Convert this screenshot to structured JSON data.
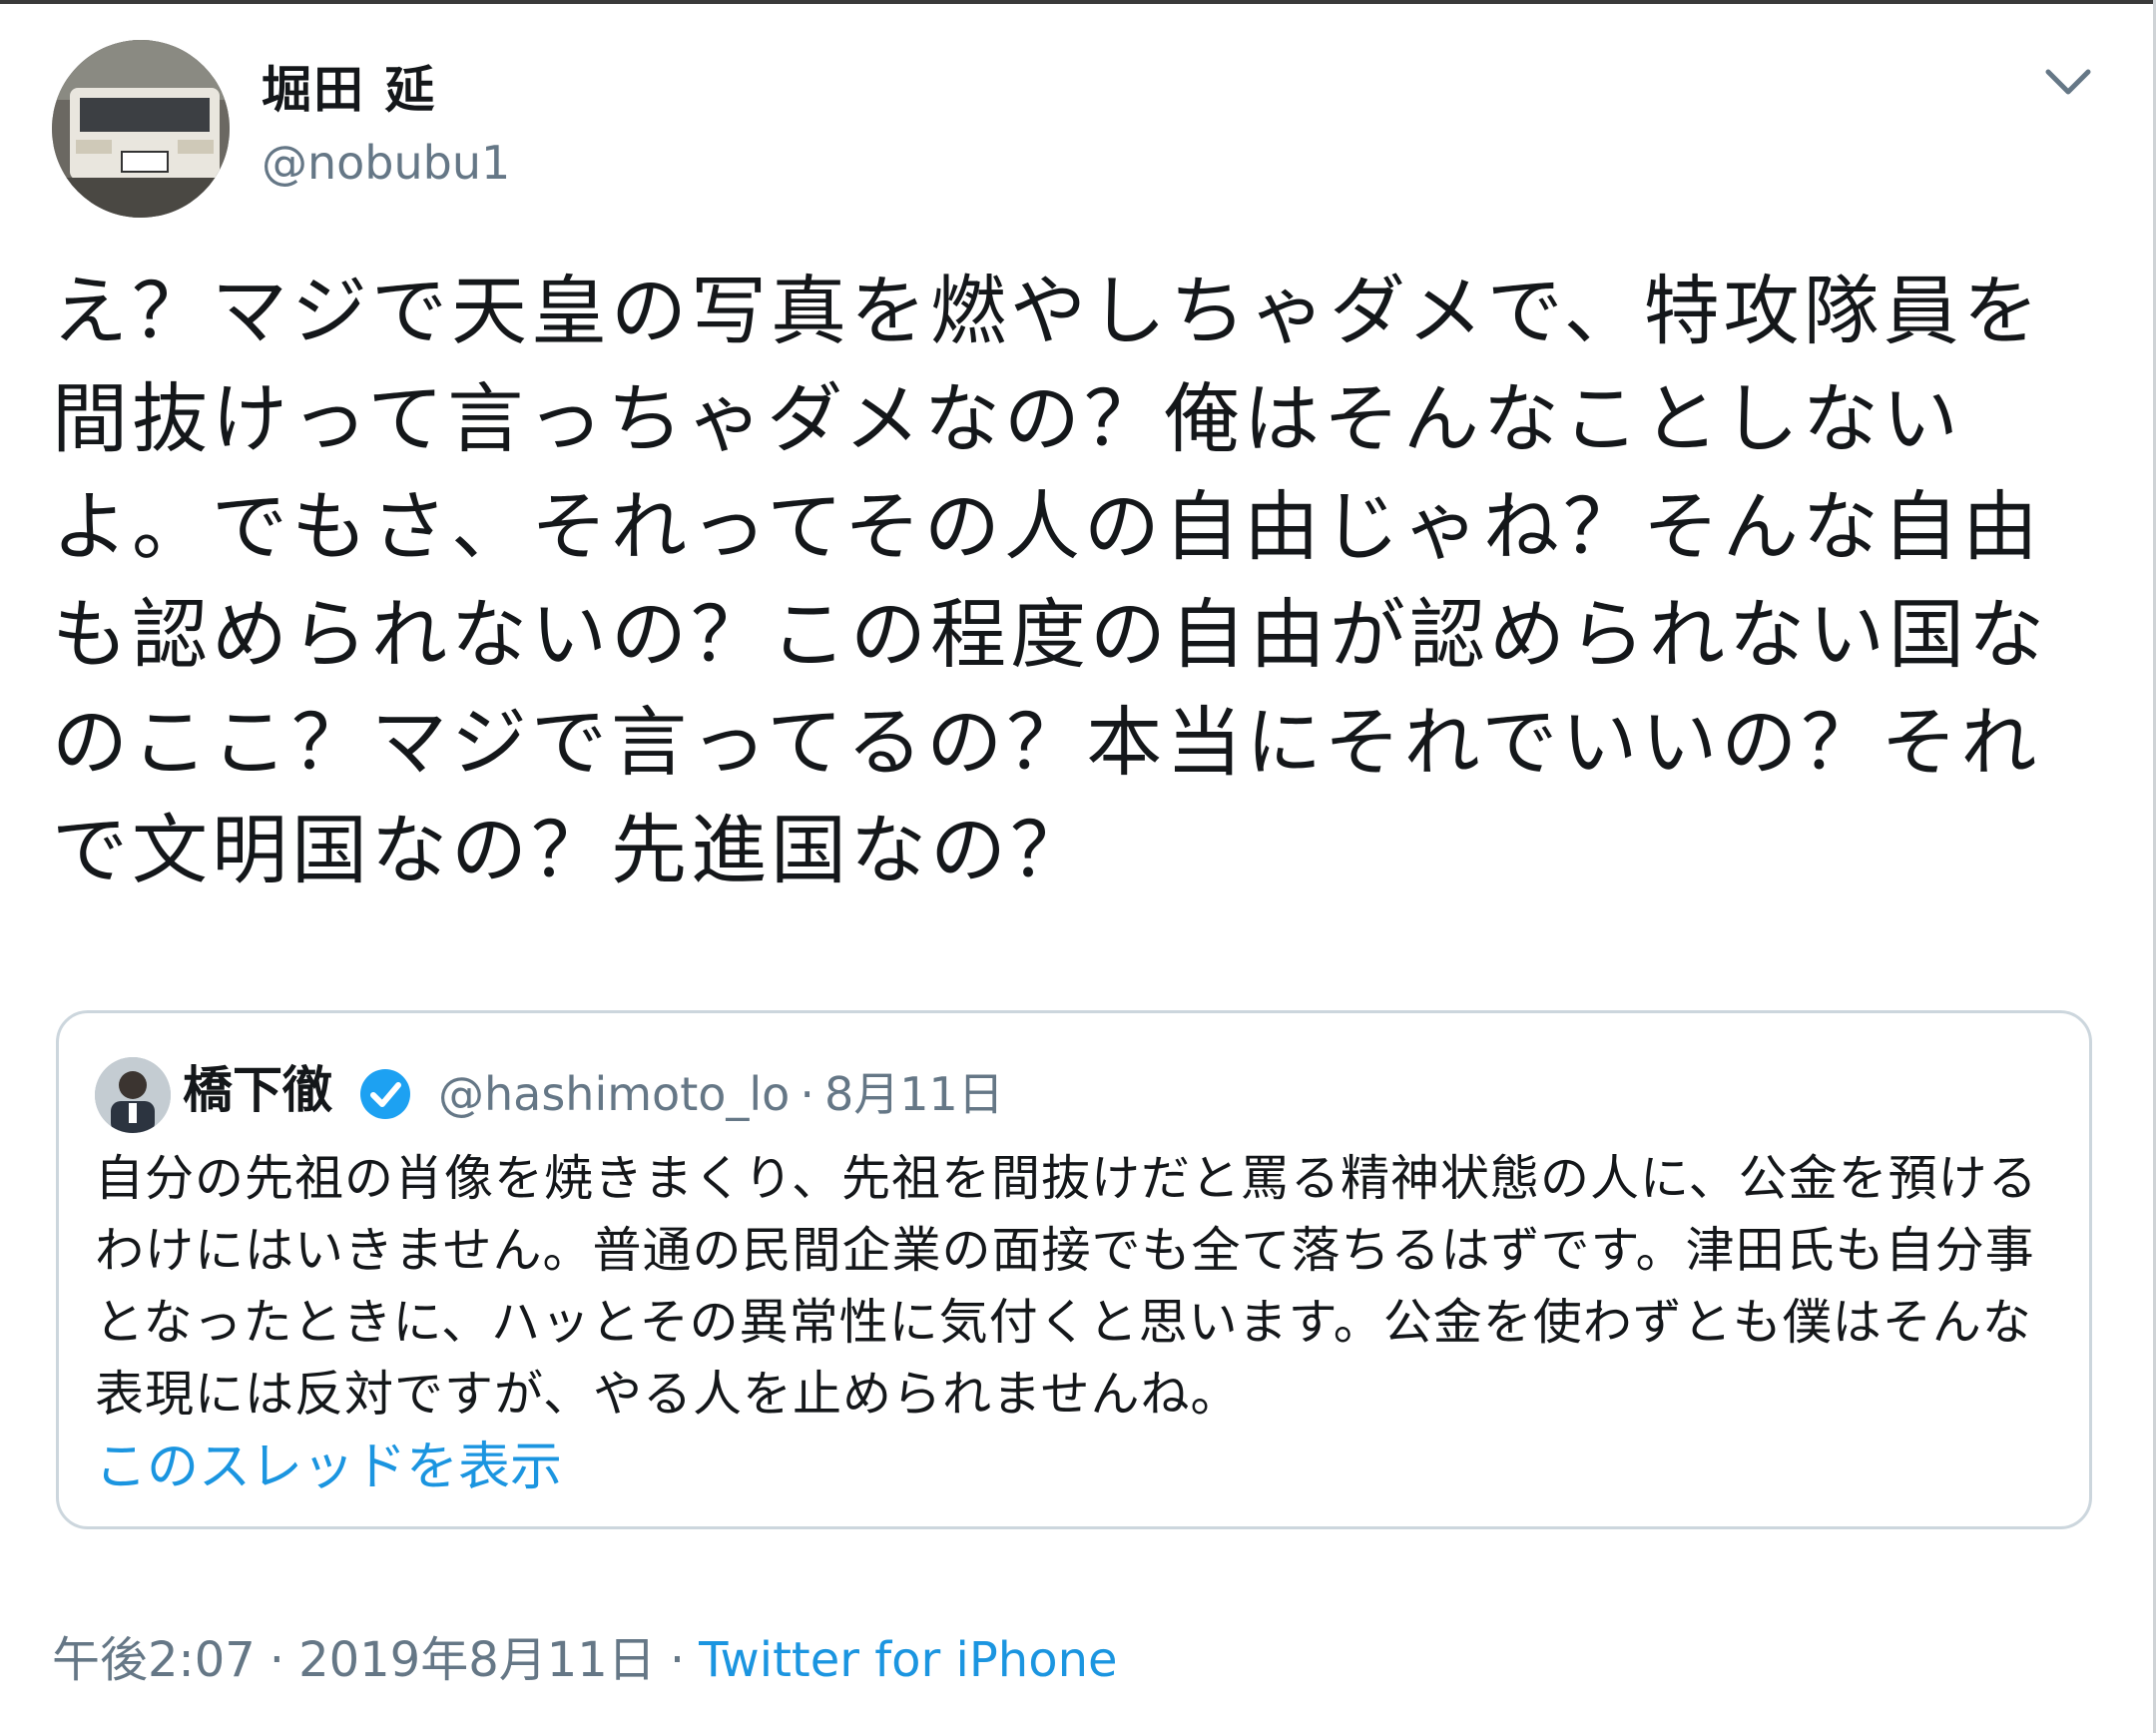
{
  "author": {
    "display_name": "堀田 延",
    "handle": "@nobubu1"
  },
  "tweet": {
    "text": "え？マジで天皇の写真を燃やしちゃダメで、特攻隊員を間抜けって言っちゃダメなの？俺はそんなことしないよ。でもさ、それってその人の自由じゃね？そんな自由も認められないの？この程度の自由が認められない国なのここ？マジで言ってるの？本当にそれでいいの？それで文明国なの？先進国なの？"
  },
  "quoted_tweet": {
    "display_name": "橋下徹",
    "handle": "@hashimoto_lo",
    "separator": "·",
    "date": "8月11日",
    "text": "自分の先祖の肖像を焼きまくり、先祖を間抜けだと罵る精神状態の人に、公金を預けるわけにはいきません。普通の民間企業の面接でも全て落ちるはずです。津田氏も自分事となったときに、ハッとその異常性に気付くと思います。公金を使わずとも僕はそんな表現には反対ですが、やる人を止められませんね。",
    "show_thread": "このスレッドを表示"
  },
  "footer": {
    "time": "午後2:07",
    "separator": "·",
    "date": "2019年8月11日",
    "source": "Twitter for iPhone"
  },
  "icons": {
    "menu": "chevron-down-icon",
    "verified": "verified-badge-icon"
  },
  "colors": {
    "link": "#1b95e0",
    "muted": "#657786",
    "text": "#14171a",
    "border": "#ccd6dd"
  }
}
